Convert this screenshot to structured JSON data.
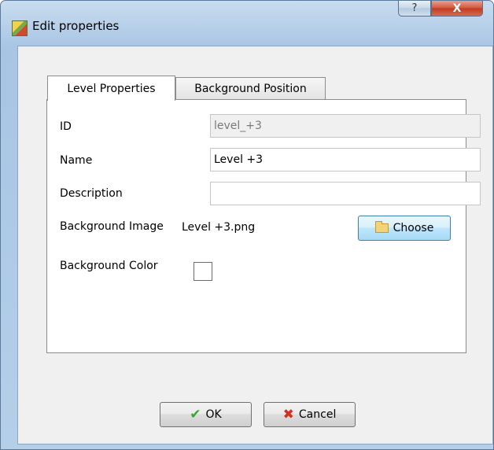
{
  "window": {
    "title": "Edit properties",
    "help_glyph": "?",
    "close_glyph": "X"
  },
  "tabs": [
    {
      "label": "Level Properties",
      "active": true
    },
    {
      "label": "Background Position",
      "active": false
    }
  ],
  "form": {
    "id_label": "ID",
    "id_value": "level_+3",
    "name_label": "Name",
    "name_value": "Level +3",
    "description_label": "Description",
    "description_value": "",
    "bg_image_label": "Background Image",
    "bg_image_value": "Level +3.png",
    "choose_label": "Choose",
    "bg_color_label": "Background Color",
    "bg_color_value": "#ffffff"
  },
  "buttons": {
    "ok_label": "OK",
    "cancel_label": "Cancel"
  },
  "icons": {
    "app": "app-icon",
    "folder": "folder-icon",
    "ok": "check-icon",
    "cancel": "x-icon"
  }
}
